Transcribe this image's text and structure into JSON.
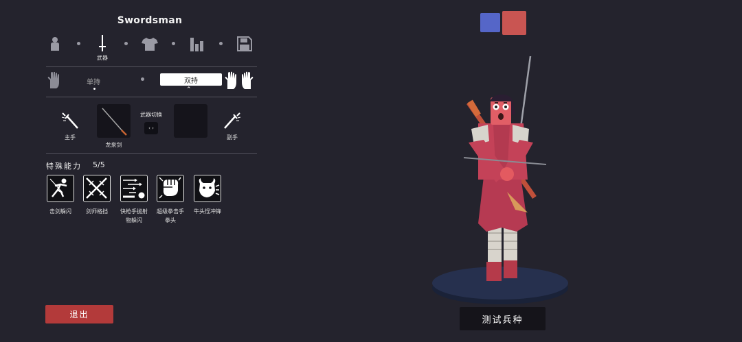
{
  "header": {
    "title": "Swordsman"
  },
  "nav": {
    "items": [
      {
        "icon": "person-icon",
        "label": ""
      },
      {
        "icon": "sword-icon",
        "label": "武器"
      },
      {
        "icon": "shirt-icon",
        "label": ""
      },
      {
        "icon": "stats-icon",
        "label": ""
      },
      {
        "icon": "save-icon",
        "label": ""
      }
    ]
  },
  "hands": {
    "single_label": "单持",
    "dual_label": "双持"
  },
  "weapons": {
    "main_label": "主手",
    "off_label": "副手",
    "main_weapon_name": "龙泉剑",
    "swap_label": "武器切换",
    "swap_glyph": "‹ ›"
  },
  "abilities": {
    "title": "特殊能力",
    "count": "5/5",
    "items": [
      {
        "icon": "dodge-icon",
        "label_line1": "击剑躲闪",
        "label_line2": ""
      },
      {
        "icon": "crossed-swords-icon",
        "label_line1": "剑师格挡",
        "label_line2": ""
      },
      {
        "icon": "projectile-dodge-icon",
        "label_line1": "快枪手抛射",
        "label_line2": "物躲闪"
      },
      {
        "icon": "fist-icon",
        "label_line1": "超级拳击手",
        "label_line2": "拳头"
      },
      {
        "icon": "bull-charge-icon",
        "label_line1": "牛头怪冲锋",
        "label_line2": ""
      }
    ]
  },
  "buttons": {
    "exit_label": "退出",
    "test_label": "测试兵种"
  },
  "teams": {
    "blue_color": "#5566c8",
    "red_color": "#c95552"
  }
}
